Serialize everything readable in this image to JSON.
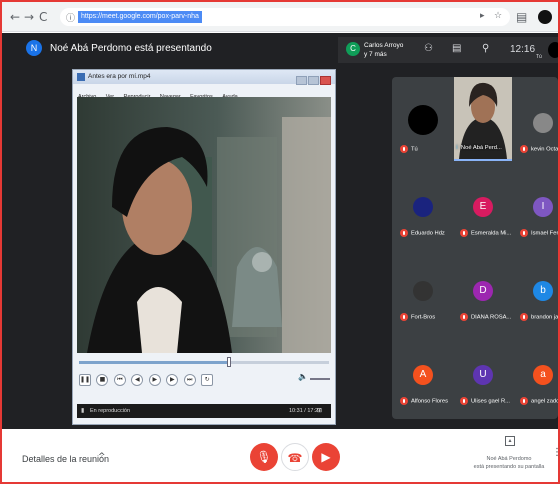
{
  "browser": {
    "back": "←",
    "forward": "→",
    "reload": "C",
    "url": "https://meet.google.com/pox-parv-nha"
  },
  "header": {
    "presenter_initial": "N",
    "presenting_title": "Noé Abá Perdomo está presentando",
    "guest_initial": "C",
    "guest_line1": "Carlos Arroyo",
    "guest_line2": "y 7 más",
    "time": "12:16",
    "tu_badge": "Tú"
  },
  "player": {
    "title": "Antes era por mí.mp4",
    "menu": [
      "Archivo",
      "Ver",
      "Reproducir",
      "Navegar",
      "Favoritos",
      "Ayuda"
    ],
    "status": "En reproducción",
    "time": "10:31 / 17:27",
    "seek_fraction": 0.6
  },
  "participants": [
    {
      "name": "Tú",
      "initial": "",
      "color": "#000000",
      "kind": "circle"
    },
    {
      "name": "Noé Abá Perd...",
      "initial": "",
      "color": "#5a4a43",
      "kind": "video"
    },
    {
      "name": "kevin Octavio",
      "initial": "",
      "color": "#888888",
      "kind": "photo"
    },
    {
      "name": "Eduardo Hdz",
      "initial": "",
      "color": "#1a237e",
      "kind": "photo"
    },
    {
      "name": "Esmeralda Mi...",
      "initial": "E",
      "color": "#d81b60",
      "kind": "letter"
    },
    {
      "name": "Ismael Fernan...",
      "initial": "I",
      "color": "#7e57c2",
      "kind": "letter"
    },
    {
      "name": "Fort-Bros",
      "initial": "",
      "color": "#333333",
      "kind": "photo"
    },
    {
      "name": "DIANA ROSA...",
      "initial": "D",
      "color": "#9c27b0",
      "kind": "letter"
    },
    {
      "name": "brandon jaim...",
      "initial": "b",
      "color": "#1e88e5",
      "kind": "letter"
    },
    {
      "name": "Alfonso Flores",
      "initial": "A",
      "color": "#f4511e",
      "kind": "letter"
    },
    {
      "name": "Ulises gael R...",
      "initial": "U",
      "color": "#5e35b1",
      "kind": "letter"
    },
    {
      "name": "angel zadquiel",
      "initial": "a",
      "color": "#f4511e",
      "kind": "letter"
    }
  ],
  "bottom": {
    "details_label": "Detalles de la reunión",
    "details_chevron": "^",
    "presenting_line1": "Noé Abá Perdomo",
    "presenting_line2": "está presentando su pantalla",
    "more": "⋮"
  },
  "colors": {
    "meet_bg": "#202124",
    "danger": "#ea4335",
    "url_highlight": "#4c8bf5"
  },
  "icons": [
    "back-icon",
    "forward-icon",
    "reload-icon",
    "lock-icon",
    "star-icon",
    "people-icon",
    "chat-icon",
    "activities-icon",
    "mic-off-icon",
    "hangup-icon",
    "camera-off-icon",
    "present-icon"
  ]
}
